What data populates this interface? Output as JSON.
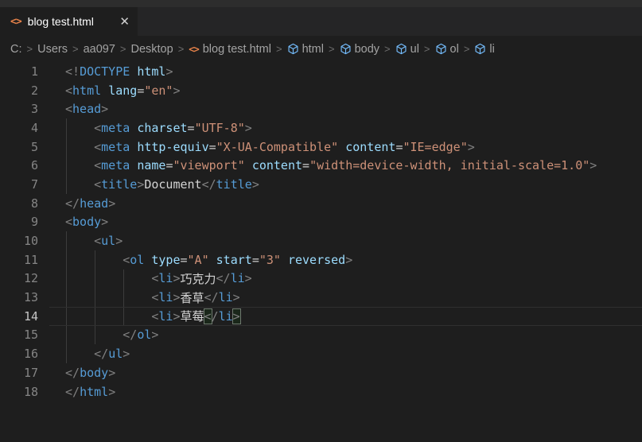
{
  "tab": {
    "title": "blog test.html",
    "html_icon_glyph": "<>",
    "close_glyph": "✕"
  },
  "breadcrumb": {
    "separator": ">",
    "segments": [
      {
        "label": "C:",
        "icon": "none"
      },
      {
        "label": "Users",
        "icon": "none"
      },
      {
        "label": "aa097",
        "icon": "none"
      },
      {
        "label": "Desktop",
        "icon": "none"
      },
      {
        "label": "blog test.html",
        "icon": "html"
      },
      {
        "label": "html",
        "icon": "element"
      },
      {
        "label": "body",
        "icon": "element"
      },
      {
        "label": "ul",
        "icon": "element"
      },
      {
        "label": "ol",
        "icon": "element"
      },
      {
        "label": "li",
        "icon": "element"
      }
    ]
  },
  "editor": {
    "active_line": 14,
    "lines": [
      {
        "num": 1,
        "tokens": [
          [
            "pun",
            "<!"
          ],
          [
            "tag",
            "DOCTYPE"
          ],
          [
            "sp",
            " "
          ],
          [
            "attr",
            "html"
          ],
          [
            "pun",
            ">"
          ]
        ]
      },
      {
        "num": 2,
        "tokens": [
          [
            "pun",
            "<"
          ],
          [
            "tag",
            "html"
          ],
          [
            "sp",
            " "
          ],
          [
            "attr",
            "lang"
          ],
          [
            "eq",
            "="
          ],
          [
            "str",
            "\"en\""
          ],
          [
            "pun",
            ">"
          ]
        ]
      },
      {
        "num": 3,
        "tokens": [
          [
            "pun",
            "<"
          ],
          [
            "tag",
            "head"
          ],
          [
            "pun",
            ">"
          ]
        ]
      },
      {
        "num": 4,
        "tokens": [
          [
            "sp",
            "    "
          ],
          [
            "pun",
            "<"
          ],
          [
            "tag",
            "meta"
          ],
          [
            "sp",
            " "
          ],
          [
            "attr",
            "charset"
          ],
          [
            "eq",
            "="
          ],
          [
            "str",
            "\"UTF-8\""
          ],
          [
            "pun",
            ">"
          ]
        ]
      },
      {
        "num": 5,
        "tokens": [
          [
            "sp",
            "    "
          ],
          [
            "pun",
            "<"
          ],
          [
            "tag",
            "meta"
          ],
          [
            "sp",
            " "
          ],
          [
            "attr",
            "http-equiv"
          ],
          [
            "eq",
            "="
          ],
          [
            "str",
            "\"X-UA-Compatible\""
          ],
          [
            "sp",
            " "
          ],
          [
            "attr",
            "content"
          ],
          [
            "eq",
            "="
          ],
          [
            "str",
            "\"IE=edge\""
          ],
          [
            "pun",
            ">"
          ]
        ]
      },
      {
        "num": 6,
        "tokens": [
          [
            "sp",
            "    "
          ],
          [
            "pun",
            "<"
          ],
          [
            "tag",
            "meta"
          ],
          [
            "sp",
            " "
          ],
          [
            "attr",
            "name"
          ],
          [
            "eq",
            "="
          ],
          [
            "str",
            "\"viewport\""
          ],
          [
            "sp",
            " "
          ],
          [
            "attr",
            "content"
          ],
          [
            "eq",
            "="
          ],
          [
            "str",
            "\"width=device-width, initial-scale=1.0\""
          ],
          [
            "pun",
            ">"
          ]
        ]
      },
      {
        "num": 7,
        "tokens": [
          [
            "sp",
            "    "
          ],
          [
            "pun",
            "<"
          ],
          [
            "tag",
            "title"
          ],
          [
            "pun",
            ">"
          ],
          [
            "txt",
            "Document"
          ],
          [
            "pun",
            "</"
          ],
          [
            "tag",
            "title"
          ],
          [
            "pun",
            ">"
          ]
        ]
      },
      {
        "num": 8,
        "tokens": [
          [
            "pun",
            "</"
          ],
          [
            "tag",
            "head"
          ],
          [
            "pun",
            ">"
          ]
        ]
      },
      {
        "num": 9,
        "tokens": [
          [
            "pun",
            "<"
          ],
          [
            "tag",
            "body"
          ],
          [
            "pun",
            ">"
          ]
        ]
      },
      {
        "num": 10,
        "tokens": [
          [
            "sp",
            "    "
          ],
          [
            "pun",
            "<"
          ],
          [
            "tag",
            "ul"
          ],
          [
            "pun",
            ">"
          ]
        ]
      },
      {
        "num": 11,
        "tokens": [
          [
            "sp",
            "        "
          ],
          [
            "pun",
            "<"
          ],
          [
            "tag",
            "ol"
          ],
          [
            "sp",
            " "
          ],
          [
            "attr",
            "type"
          ],
          [
            "eq",
            "="
          ],
          [
            "str",
            "\"A\""
          ],
          [
            "sp",
            " "
          ],
          [
            "attr",
            "start"
          ],
          [
            "eq",
            "="
          ],
          [
            "str",
            "\"3\""
          ],
          [
            "sp",
            " "
          ],
          [
            "attr",
            "reversed"
          ],
          [
            "pun",
            ">"
          ]
        ]
      },
      {
        "num": 12,
        "tokens": [
          [
            "sp",
            "            "
          ],
          [
            "pun",
            "<"
          ],
          [
            "tag",
            "li"
          ],
          [
            "pun",
            ">"
          ],
          [
            "txt",
            "巧克力"
          ],
          [
            "pun",
            "</"
          ],
          [
            "tag",
            "li"
          ],
          [
            "pun",
            ">"
          ]
        ]
      },
      {
        "num": 13,
        "tokens": [
          [
            "sp",
            "            "
          ],
          [
            "pun",
            "<"
          ],
          [
            "tag",
            "li"
          ],
          [
            "pun",
            ">"
          ],
          [
            "txt",
            "香草"
          ],
          [
            "pun",
            "</"
          ],
          [
            "tag",
            "li"
          ],
          [
            "pun",
            ">"
          ]
        ]
      },
      {
        "num": 14,
        "tokens": [
          [
            "sp",
            "            "
          ],
          [
            "pun",
            "<"
          ],
          [
            "tag",
            "li"
          ],
          [
            "pun",
            ">"
          ],
          [
            "txt",
            "草莓"
          ],
          [
            "brk",
            "<"
          ],
          [
            "pun",
            "/"
          ],
          [
            "tag",
            "li"
          ],
          [
            "brk",
            ">"
          ]
        ]
      },
      {
        "num": 15,
        "tokens": [
          [
            "sp",
            "        "
          ],
          [
            "pun",
            "</"
          ],
          [
            "tag",
            "ol"
          ],
          [
            "pun",
            ">"
          ]
        ]
      },
      {
        "num": 16,
        "tokens": [
          [
            "sp",
            "    "
          ],
          [
            "pun",
            "</"
          ],
          [
            "tag",
            "ul"
          ],
          [
            "pun",
            ">"
          ]
        ]
      },
      {
        "num": 17,
        "tokens": [
          [
            "pun",
            "</"
          ],
          [
            "tag",
            "body"
          ],
          [
            "pun",
            ">"
          ]
        ]
      },
      {
        "num": 18,
        "tokens": [
          [
            "pun",
            "</"
          ],
          [
            "tag",
            "html"
          ],
          [
            "pun",
            ">"
          ]
        ]
      }
    ]
  },
  "colors": {
    "editor_bg": "#1e1e1e",
    "tabbar_bg": "#252526",
    "title_strip_bg": "#2d2d2d",
    "tag": "#569cd6",
    "attribute": "#9cdcfe",
    "string": "#ce9178",
    "punctuation": "#808080",
    "text": "#d4d4d4",
    "line_number": "#858585",
    "active_line_number": "#c6c6c6",
    "html_icon": "#e8834a",
    "element_icon": "#75beff"
  }
}
